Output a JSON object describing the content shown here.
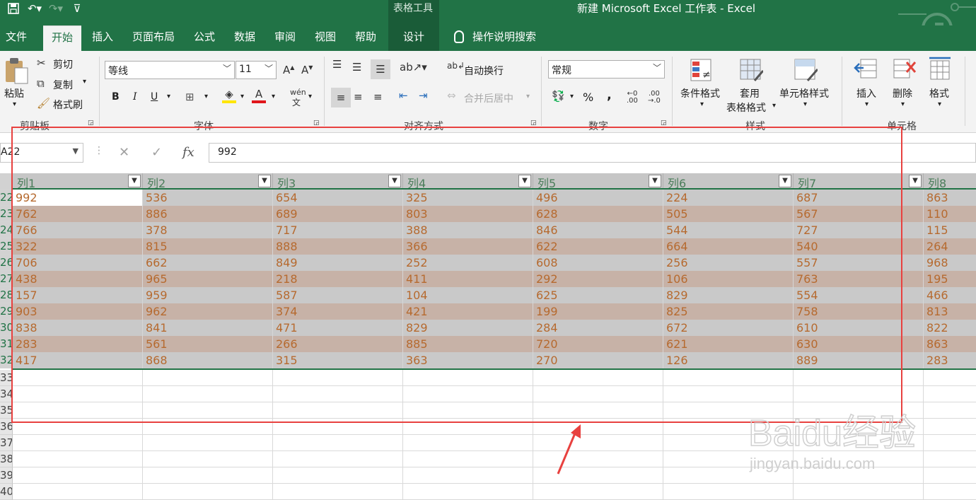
{
  "titlebar": {
    "context_group": "表格工具",
    "window_title": "新建 Microsoft Excel 工作表  -  Excel",
    "qat_icons": [
      "save-icon",
      "undo-icon",
      "redo-icon",
      "customize-qat-icon"
    ]
  },
  "tabs": [
    {
      "label": "文件"
    },
    {
      "label": "开始"
    },
    {
      "label": "插入"
    },
    {
      "label": "页面布局"
    },
    {
      "label": "公式"
    },
    {
      "label": "数据"
    },
    {
      "label": "审阅"
    },
    {
      "label": "视图"
    },
    {
      "label": "帮助"
    },
    {
      "label": "设计"
    },
    {
      "label": "操作说明搜索"
    }
  ],
  "ribbon": {
    "clipboard": {
      "paste": "粘贴",
      "cut": "剪切",
      "copy": "复制",
      "format_painter": "格式刷",
      "label": "剪贴板"
    },
    "font": {
      "name": "等线",
      "size": "11",
      "bold": "B",
      "italic": "I",
      "underline": "U",
      "label": "字体",
      "phonetic": "wén"
    },
    "alignment": {
      "wrap_text": "自动换行",
      "merge_center": "合并后居中",
      "label": "对齐方式"
    },
    "number": {
      "format": "常规",
      "percent": "%",
      "comma": ",",
      "label": "数字"
    },
    "styles": {
      "conditional": "条件格式",
      "table_format_1": "套用",
      "table_format_2": "表格格式",
      "cell_styles": "单元格样式",
      "label": "样式"
    },
    "cells": {
      "insert": "插入",
      "delete": "删除",
      "format": "格式",
      "label": "单元格"
    }
  },
  "formula_bar": {
    "name_box": "A22",
    "fx": "fx",
    "value": "992"
  },
  "table": {
    "headers": [
      "列1",
      "列2",
      "列3",
      "列4",
      "列5",
      "列6",
      "列7",
      "列8"
    ],
    "row_numbers": [
      "22",
      "23",
      "24",
      "25",
      "26",
      "27",
      "28",
      "29",
      "30",
      "31",
      "32"
    ],
    "rows": [
      [
        "992",
        "536",
        "654",
        "325",
        "496",
        "224",
        "687",
        "863"
      ],
      [
        "762",
        "886",
        "689",
        "803",
        "628",
        "505",
        "567",
        "110"
      ],
      [
        "766",
        "378",
        "717",
        "388",
        "846",
        "544",
        "727",
        "115"
      ],
      [
        "322",
        "815",
        "888",
        "366",
        "622",
        "664",
        "540",
        "264"
      ],
      [
        "706",
        "662",
        "849",
        "252",
        "608",
        "256",
        "557",
        "968"
      ],
      [
        "438",
        "965",
        "218",
        "411",
        "292",
        "106",
        "763",
        "195"
      ],
      [
        "157",
        "959",
        "587",
        "104",
        "625",
        "829",
        "554",
        "466"
      ],
      [
        "903",
        "962",
        "374",
        "421",
        "199",
        "825",
        "758",
        "813"
      ],
      [
        "838",
        "841",
        "471",
        "829",
        "284",
        "672",
        "610",
        "822"
      ],
      [
        "283",
        "561",
        "266",
        "885",
        "720",
        "621",
        "630",
        "863"
      ],
      [
        "417",
        "868",
        "315",
        "363",
        "270",
        "126",
        "889",
        "283"
      ]
    ],
    "empty_row_numbers": [
      "33",
      "34",
      "35",
      "36",
      "37",
      "38",
      "39",
      "40"
    ]
  },
  "watermark": {
    "brand": "Baidu经验",
    "url": "jingyan.baidu.com"
  }
}
